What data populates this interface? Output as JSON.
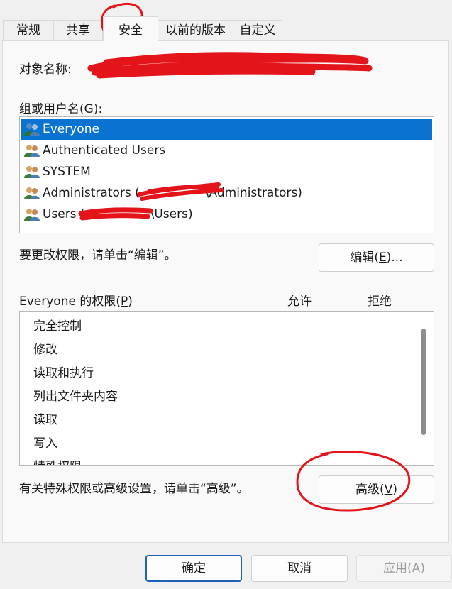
{
  "tabs": [
    {
      "label": "常规"
    },
    {
      "label": "共享"
    },
    {
      "label": "安全"
    },
    {
      "label": "以前的版本"
    },
    {
      "label": "自定义"
    }
  ],
  "object_name_label": "对象名称:",
  "group_label_prefix": "组或用户名(",
  "group_label_key": "G",
  "group_label_suffix": "):",
  "users": [
    {
      "label": "Everyone",
      "selected": true
    },
    {
      "label": "Authenticated Users",
      "selected": false
    },
    {
      "label": "SYSTEM",
      "selected": false
    },
    {
      "label_prefix": "Administrators (",
      "label_suffix": "\\Administrators)",
      "selected": false
    },
    {
      "label_prefix": "Users (",
      "label_suffix": "\\Users)",
      "selected": false
    }
  ],
  "change_hint": "要更改权限，请单击“编辑”。",
  "edit_button": {
    "prefix": "编辑(",
    "key": "E",
    "suffix": ")..."
  },
  "perm_header": {
    "prefix": "Everyone 的权限(",
    "key": "P",
    "suffix": ")",
    "allow": "允许",
    "deny": "拒绝"
  },
  "permissions": [
    "完全控制",
    "修改",
    "读取和执行",
    "列出文件夹内容",
    "读取",
    "写入",
    "特殊权限"
  ],
  "advanced_hint": "有关特殊权限或高级设置，请单击“高级”。",
  "advanced_button": {
    "prefix": "高级(",
    "key": "V",
    "suffix": ")"
  },
  "footer": {
    "ok": "确定",
    "cancel": "取消",
    "apply_prefix": "应用(",
    "apply_key": "A",
    "apply_suffix": ")"
  },
  "colors": {
    "selection": "#0a72d1",
    "annotation": "#e3151b"
  }
}
